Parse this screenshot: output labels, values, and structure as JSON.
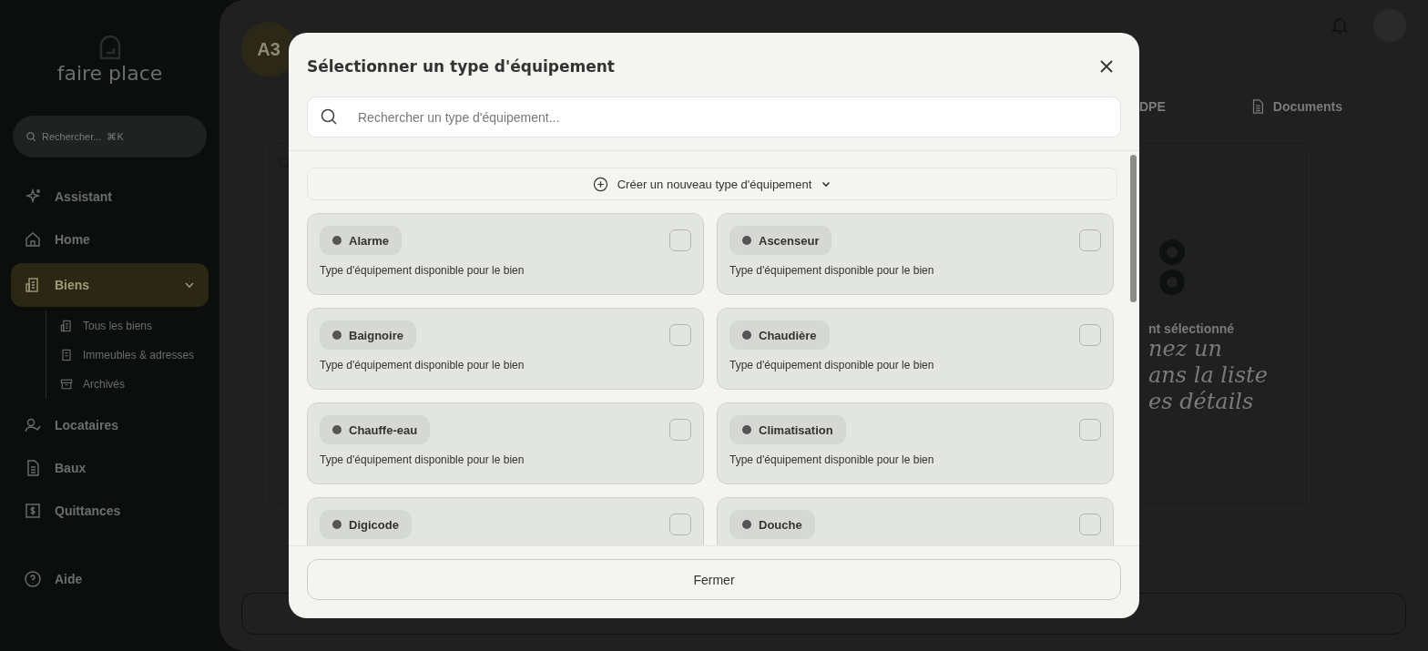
{
  "sidebar": {
    "logo": "faire place",
    "search": {
      "placeholder": "Rechercher...",
      "shortcut": "⌘K"
    },
    "items": [
      {
        "label": "Assistant",
        "selected": false
      },
      {
        "label": "Home",
        "selected": false
      },
      {
        "label": "Biens",
        "selected": true,
        "expanded": true,
        "children": [
          {
            "label": "Tous les biens"
          },
          {
            "label": "Immeubles & adresses"
          },
          {
            "label": "Archivés"
          }
        ]
      },
      {
        "label": "Locataires",
        "selected": false
      },
      {
        "label": "Baux",
        "selected": false
      },
      {
        "label": "Quittances",
        "selected": false
      }
    ],
    "help": "Aide"
  },
  "main": {
    "avatar": "A3",
    "tabs": [
      {
        "label": "DPE"
      },
      {
        "label": "Documents"
      }
    ],
    "empty_state": {
      "title": "nt sélectionné",
      "lines": [
        "nez un",
        "ans la liste",
        "es détails"
      ]
    }
  },
  "modal": {
    "title": "Sélectionner un type d'équipement",
    "search": {
      "placeholder": "Rechercher un type d'équipement..."
    },
    "create_label": "Créer un nouveau type d'équipement",
    "items": [
      {
        "name": "Alarme",
        "description": "Type d'équipement disponible pour le bien",
        "checked": false
      },
      {
        "name": "Ascenseur",
        "description": "Type d'équipement disponible pour le bien",
        "checked": false
      },
      {
        "name": "Baignoire",
        "description": "Type d'équipement disponible pour le bien",
        "checked": false
      },
      {
        "name": "Chaudière",
        "description": "Type d'équipement disponible pour le bien",
        "checked": false
      },
      {
        "name": "Chauffe-eau",
        "description": "Type d'équipement disponible pour le bien",
        "checked": false
      },
      {
        "name": "Climatisation",
        "description": "Type d'équipement disponible pour le bien",
        "checked": false
      },
      {
        "name": "Digicode",
        "checked": false
      },
      {
        "name": "Douche",
        "checked": false
      }
    ],
    "close_button": "Fermer"
  }
}
